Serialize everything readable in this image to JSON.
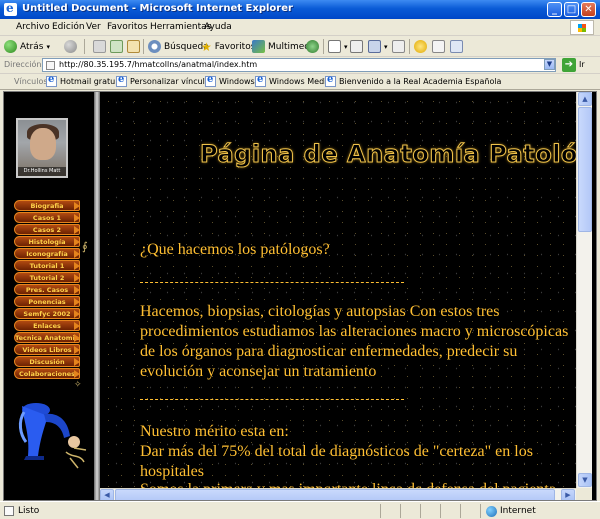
{
  "window": {
    "title": "Untitled Document - Microsoft Internet Explorer",
    "controls": {
      "minimize": "_",
      "maximize": "□",
      "close": "✕"
    }
  },
  "menu": [
    "Archivo",
    "Edición",
    "Ver",
    "Favoritos",
    "Herramientas",
    "Ayuda"
  ],
  "toolbar": {
    "back": "Atrás",
    "search": "Búsqueda",
    "favorites": "Favoritos",
    "multimedia": "Multimedia"
  },
  "address": {
    "label": "Dirección",
    "url": "http://80.35.195.7/hmatcollns/anatmal/index.htm",
    "go": "Ir"
  },
  "links": {
    "label": "Vínculos",
    "items": [
      "Hotmail gratuito",
      "Personalizar vínculos",
      "Windows",
      "Windows Media",
      "Bienvenido a la Real Academia Española"
    ]
  },
  "sidebar": {
    "photo_caption": "Dr.Hollins Matt",
    "nav": [
      "Biografia",
      "Casos 1",
      "Casos 2",
      "Histología",
      "Iconografía",
      "Tutorial 1",
      "Tutorial 2",
      "Pres. Casos",
      "Ponencias",
      "Semfyc 2002",
      "Enlaces",
      "Tecnica Anatomia",
      "Videos Libros",
      "Discusión",
      "Colaboraciones"
    ]
  },
  "content": {
    "title": "Página de Anatomía Patológica",
    "question": "¿Que hacemos los patólogos?",
    "paragraph1": [
      "Hacemos, biopsias, citologías y autopsias Con estos tres",
      "procedimientos estudiamos las alteraciones macro y microscópicas",
      "de los órganos para diagnosticar enfermedades, predecir su",
      "evolución y aconsejar un tratamiento"
    ],
    "paragraph2": [
      "Nuestro mérito esta en:",
      "Dar más del 75% del total de diagnósticos de \"certeza\" en los",
      "hospitales",
      "Somos la primera y mas importante linea de defensa del paciente"
    ]
  },
  "status": {
    "text": "Listo",
    "zone": "Internet"
  },
  "colors": {
    "text": "#ffbf32",
    "background": "#000000",
    "nav_button": "#8a3206"
  }
}
